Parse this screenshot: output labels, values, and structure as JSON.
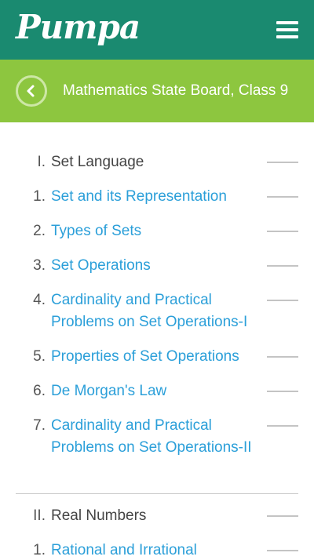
{
  "header": {
    "logo": "Pumpa"
  },
  "subheader": {
    "title": "Mathematics State Board, Class 9"
  },
  "units": [
    {
      "number": "I.",
      "title": "Set Language",
      "lessons": [
        {
          "number": "1.",
          "title": "Set and its Representation"
        },
        {
          "number": "2.",
          "title": "Types of Sets"
        },
        {
          "number": "3.",
          "title": "Set Operations"
        },
        {
          "number": "4.",
          "title": "Cardinality and Practical Problems on Set Operations-I"
        },
        {
          "number": "5.",
          "title": "Properties of Set Operations"
        },
        {
          "number": "6.",
          "title": "De Morgan's Law"
        },
        {
          "number": "7.",
          "title": "Cardinality and Practical Problems on Set Operations-II"
        }
      ]
    },
    {
      "number": "II.",
      "title": "Real Numbers",
      "lessons": [
        {
          "number": "1.",
          "title": "Rational and Irrational"
        }
      ]
    }
  ],
  "icons": {
    "menu": "hamburger-menu-icon",
    "back": "chevron-left-circle-icon"
  },
  "colors": {
    "topbar": "#1a8a70",
    "subbar": "#8dc63f",
    "link": "#2b9fd9"
  }
}
